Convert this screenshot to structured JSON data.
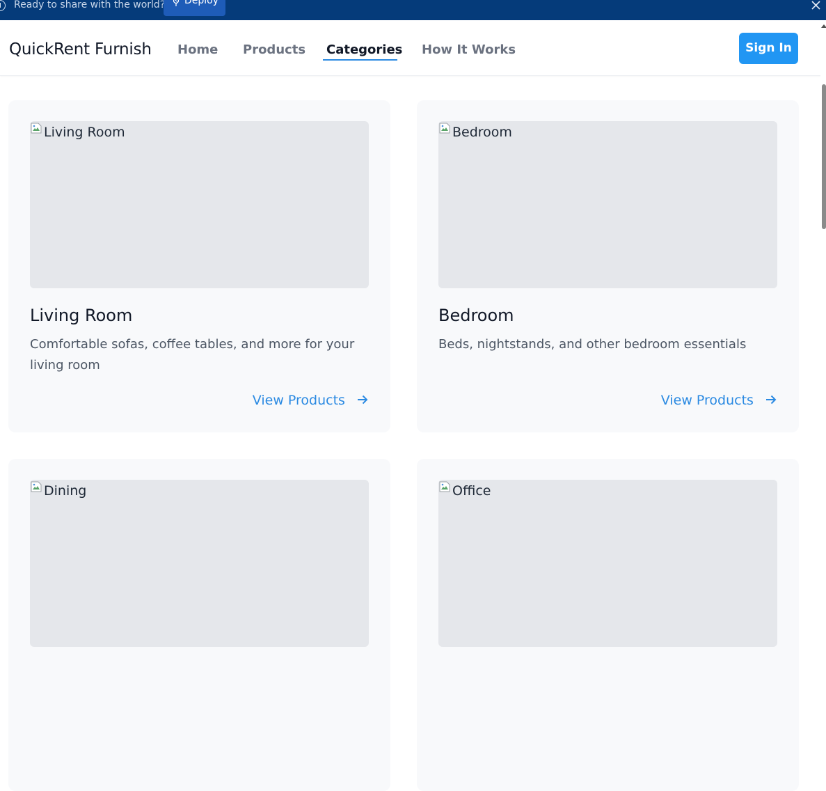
{
  "banner": {
    "text": "Ready to share with the world?",
    "deploy_label": "Deploy"
  },
  "header": {
    "brand": "QuickRent Furnish",
    "nav": [
      "Home",
      "Products",
      "Categories",
      "How It Works"
    ],
    "active_nav": "Categories",
    "signin_label": "Sign In"
  },
  "categories": [
    {
      "image_alt": "Living Room",
      "title": "Living Room",
      "description": "Comfortable sofas, coffee tables, and more for your living room",
      "link": "View Products"
    },
    {
      "image_alt": "Bedroom",
      "title": "Bedroom",
      "description": "Beds, nightstands, and other bedroom essentials",
      "link": "View Products"
    },
    {
      "image_alt": "Dining",
      "title": "",
      "description": "",
      "link": ""
    },
    {
      "image_alt": "Office",
      "title": "",
      "description": "",
      "link": ""
    }
  ],
  "colors": {
    "banner": "#053b7a",
    "accent": "#2196f3",
    "link": "#2b8ae2",
    "card_bg": "#f8f9fb",
    "image_placeholder": "#e5e7eb"
  },
  "icons": [
    "info-icon",
    "deploy-icon",
    "close-icon",
    "broken-image-icon",
    "arrow-right-icon"
  ]
}
